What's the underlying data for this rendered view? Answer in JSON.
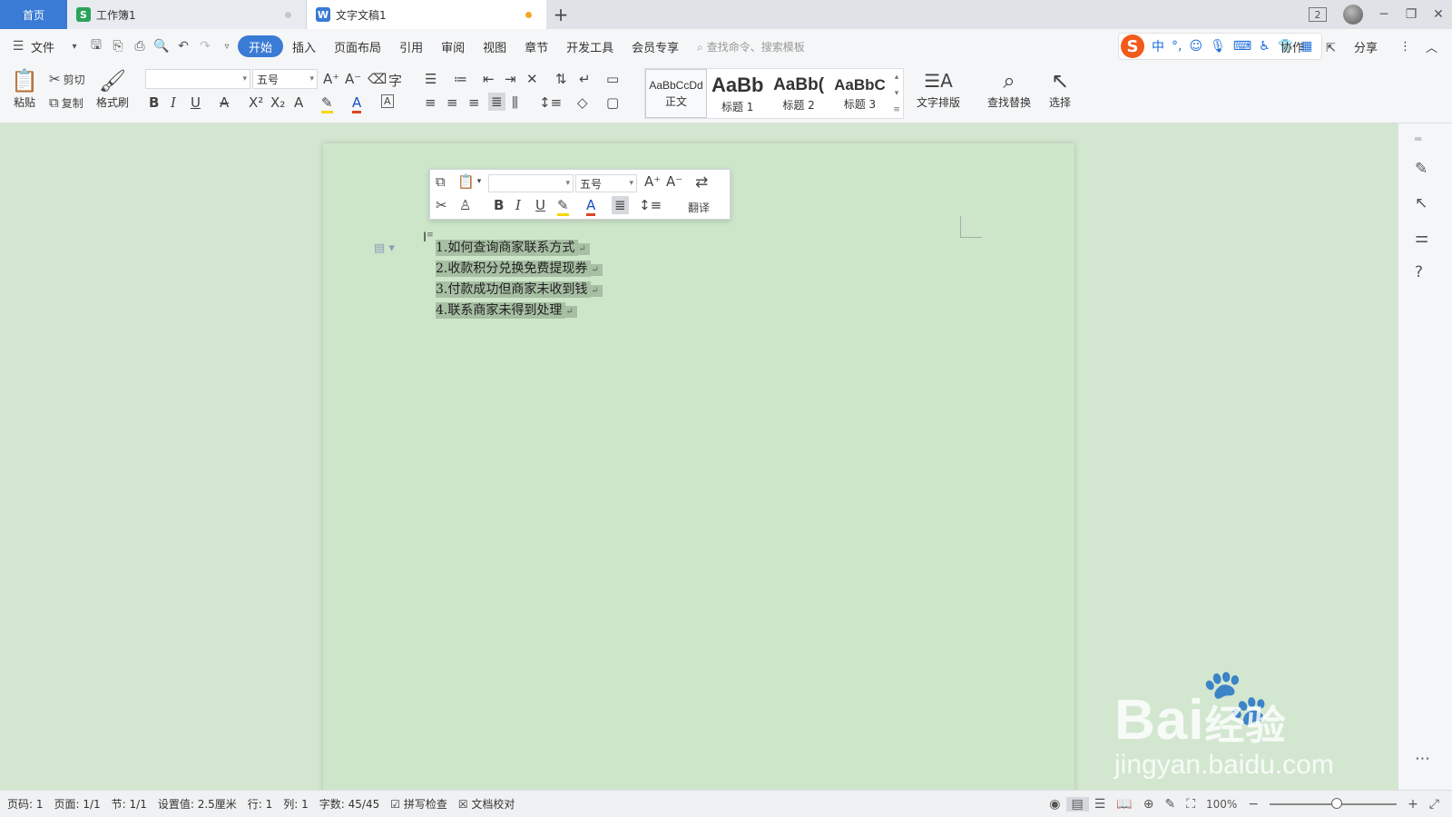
{
  "tabs": {
    "home": "首页",
    "workbook": {
      "label": "工作簿1",
      "icon_letter": "S",
      "icon_color": "#2aa35a"
    },
    "document": {
      "label": "文字文稿1",
      "icon_letter": "W",
      "icon_color": "#3a7bd5",
      "unsaved_dot_color": "#f5a623"
    },
    "add": "+"
  },
  "window": {
    "page_indicator": "2"
  },
  "menu": {
    "file": "文件",
    "items": [
      "开始",
      "插入",
      "页面布局",
      "引用",
      "审阅",
      "视图",
      "章节",
      "开发工具",
      "会员专享"
    ],
    "active_index": 0,
    "search_placeholder": "查找命令、搜索模板",
    "collab": "协作",
    "share": "分享"
  },
  "ime": {
    "logo": "S",
    "mode": "中",
    "punct": "°,"
  },
  "ribbon": {
    "paste": "粘贴",
    "cut": "剪切",
    "copy": "复制",
    "format_painter": "格式刷",
    "font_name": "",
    "font_size": "五号",
    "styles": [
      {
        "preview": "AaBbCcDd",
        "label": "正文"
      },
      {
        "preview": "AaBb",
        "label": "标题 1"
      },
      {
        "preview": "AaBb(",
        "label": "标题 2"
      },
      {
        "preview": "AaBbC",
        "label": "标题 3"
      }
    ],
    "text_layout": "文字排版",
    "find_replace": "查找替换",
    "select": "选择"
  },
  "mini_toolbar": {
    "font_name": "",
    "font_size": "五号",
    "translate": "翻译"
  },
  "document": {
    "list": [
      "1.如何查询商家联系方式",
      "2.收款积分兑换免费提现券",
      "3.付款成功但商家未收到钱",
      "4.联系商家未得到处理"
    ],
    "highlight_color": "#a7bfa3"
  },
  "status": {
    "page_num": "页码: 1",
    "pages": "页面: 1/1",
    "section": "节: 1/1",
    "setting": "设置值: 2.5厘米",
    "row": "行: 1",
    "col": "列: 1",
    "word_count": "字数: 45/45",
    "spell_check": "拼写检查",
    "doc_proof": "文档校对",
    "zoom": "100%"
  },
  "watermark": {
    "brand": "Bai",
    "brand_cn": "经验",
    "url": "jingyan.baidu.com"
  }
}
